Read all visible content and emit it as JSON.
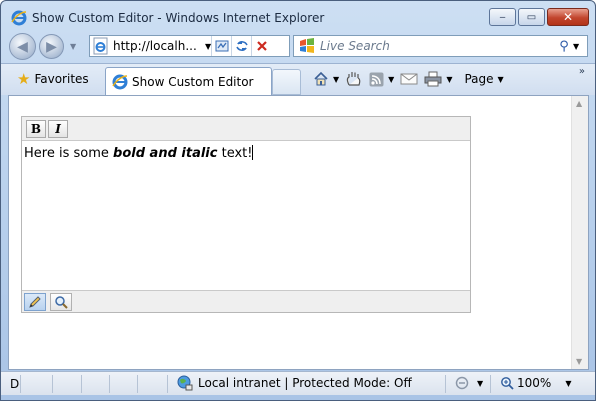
{
  "window": {
    "title": "Show Custom Editor - Windows Internet Explorer",
    "min_label": "‒",
    "max_label": "▭",
    "close_label": "✕"
  },
  "addressbar": {
    "url": "http://localh..."
  },
  "search": {
    "placeholder": "Live Search"
  },
  "tabrow": {
    "favorites_label": "Favorites",
    "tab_label": "Show Custom Editor",
    "page_label": "Page"
  },
  "editor": {
    "bold_label": "B",
    "italic_label": "I",
    "text_before": "Here is some ",
    "text_bold_italic": "bold and italic",
    "text_after": " text!"
  },
  "statusbar": {
    "status_text": "Done",
    "zone_text": "Local intranet | Protected Mode: Off",
    "zoom_text": "100%"
  },
  "colors": {
    "chrome": "#bcd3ee",
    "close_button": "#c2452d",
    "link_blue": "#2d5aa8"
  }
}
